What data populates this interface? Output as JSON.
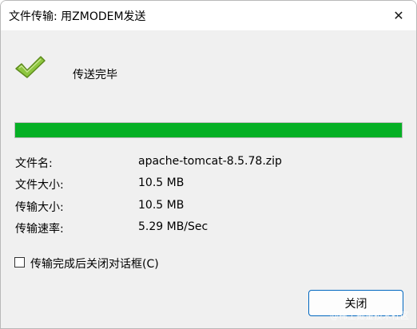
{
  "window": {
    "title": "文件传输: 用ZMODEM发送",
    "close_glyph": "✕"
  },
  "status": {
    "icon": "checkmark-icon",
    "text": "传送完毕",
    "check_color": "#8dc63f"
  },
  "progress": {
    "percent": 100,
    "color": "#06b025"
  },
  "info": {
    "filename_label": "文件名:",
    "filename_value": "apache-tomcat-8.5.78.zip",
    "filesize_label": "文件大小:",
    "filesize_value": "10.5 MB",
    "transferred_label": "传输大小:",
    "transferred_value": "10.5 MB",
    "rate_label": "传输速率:",
    "rate_value": "5.29 MB/Sec"
  },
  "options": {
    "autoclose_label": "传输完成后关闭对话框(C)",
    "autoclose_checked": false
  },
  "buttons": {
    "close_label": "关闭"
  },
  "watermark": "@稀土掘金技术社区"
}
